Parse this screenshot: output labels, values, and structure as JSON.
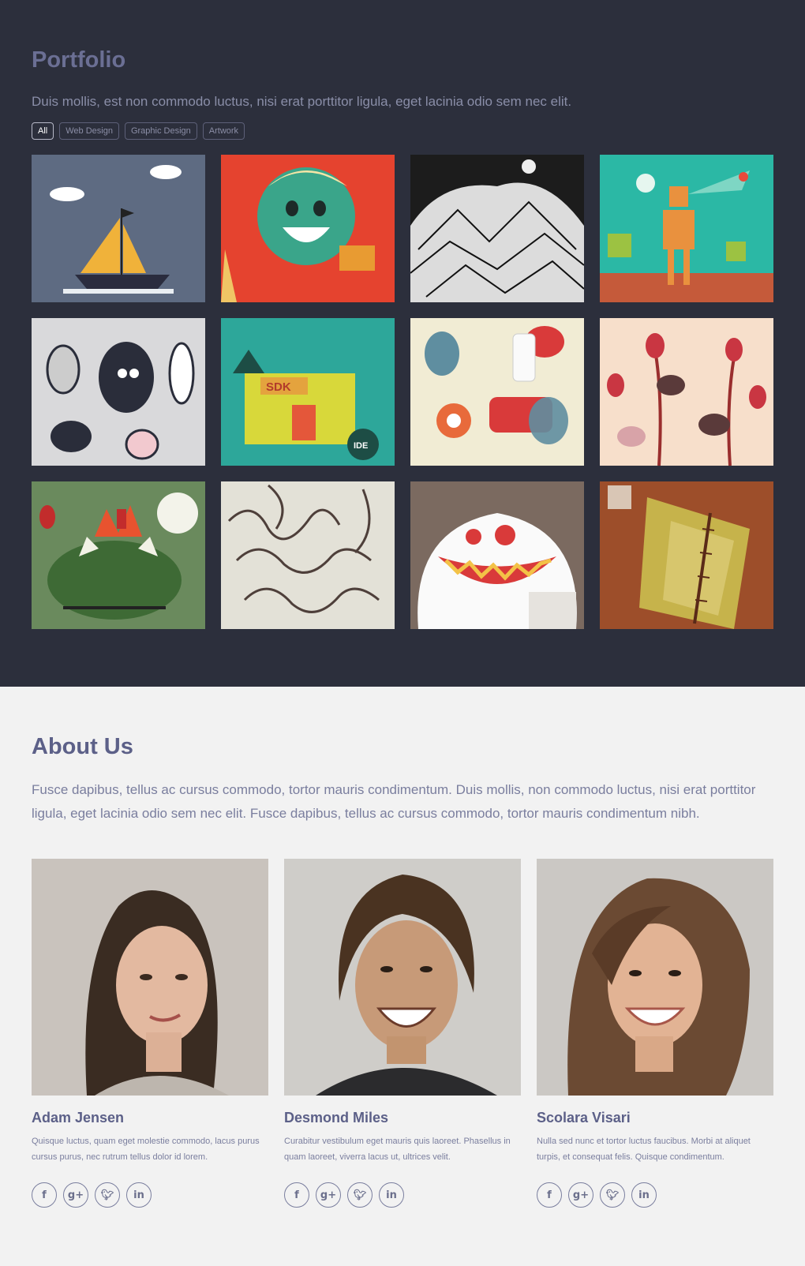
{
  "portfolio": {
    "title": "Portfolio",
    "lead": "Duis mollis, est non commodo luctus, nisi erat porttitor ligula, eget lacinia odio sem nec elit.",
    "filters": [
      "All",
      "Web Design",
      "Graphic Design",
      "Artwork"
    ],
    "active_filter": "All"
  },
  "about": {
    "title": "About Us",
    "lead": "Fusce dapibus, tellus ac cursus commodo, tortor mauris condimentum. Duis mollis, non commodo luctus, nisi erat porttitor ligula, eget lacinia odio sem nec elit. Fusce dapibus, tellus ac cursus commodo, tortor mauris condimentum nibh.",
    "members": [
      {
        "name": "Adam Jensen",
        "bio": "Quisque luctus, quam eget molestie commodo, lacus purus cursus purus, nec rutrum tellus dolor id lorem."
      },
      {
        "name": "Desmond Miles",
        "bio": "Curabitur vestibulum eget mauris quis laoreet. Phasellus in quam laoreet, viverra lacus ut, ultrices velit."
      },
      {
        "name": "Scolara Visari",
        "bio": "Nulla sed nunc et tortor luctus faucibus. Morbi at aliquet turpis, et consequat felis. Quisque condimentum."
      }
    ],
    "social_icons": [
      "facebook-icon",
      "google-plus-icon",
      "twitter-icon",
      "linkedin-icon"
    ]
  },
  "colors": {
    "dark_bg": "#2c2f3c",
    "light_bg": "#f2f2f2",
    "heading": "#5c6088",
    "text": "#7a7e9e"
  }
}
